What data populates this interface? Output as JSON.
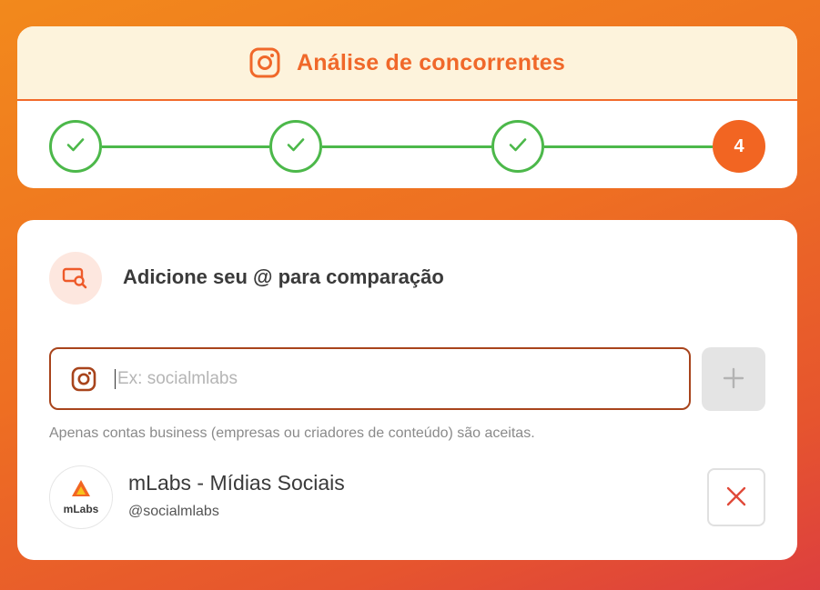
{
  "header": {
    "title": "Análise de concorrentes",
    "icon": "instagram-icon",
    "accent_color": "#f0682a"
  },
  "stepper": {
    "steps": [
      {
        "state": "completed",
        "icon": "check-icon"
      },
      {
        "state": "completed",
        "icon": "check-icon"
      },
      {
        "state": "completed",
        "icon": "check-icon"
      },
      {
        "state": "active",
        "label": "4"
      }
    ],
    "completed_color": "#4cb84a",
    "active_color": "#f26522"
  },
  "section": {
    "icon": "profile-search-icon",
    "title": "Adicione seu @ para comparação"
  },
  "search": {
    "icon": "instagram-icon",
    "placeholder": "Ex: socialmlabs",
    "value": ""
  },
  "add_button": {
    "icon": "plus-icon"
  },
  "hint": "Apenas contas business (empresas ou criadores de conteúdo) são aceitas.",
  "account": {
    "avatar_text": "mLabs",
    "name": "mLabs - Mídias Sociais",
    "handle": "@socialmlabs"
  },
  "remove_button": {
    "icon": "close-icon",
    "color": "#e04a3a"
  }
}
